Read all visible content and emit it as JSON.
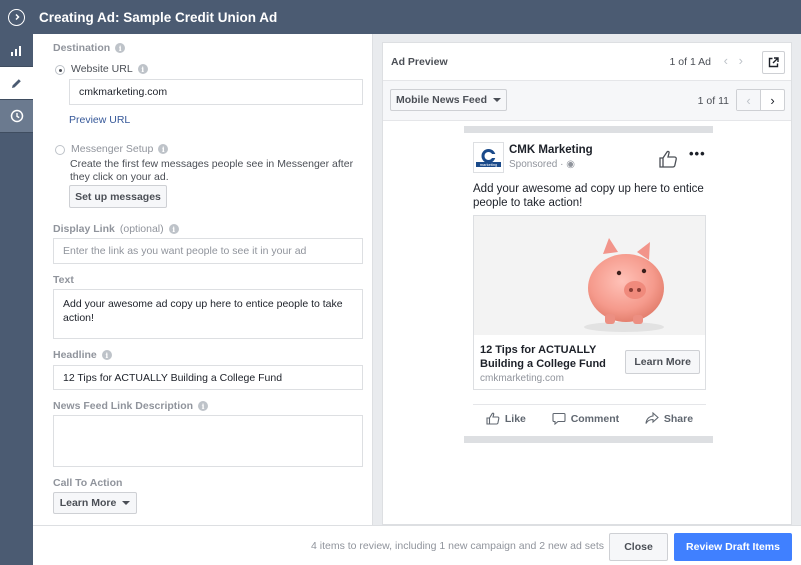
{
  "header": {
    "title": "Creating Ad: Sample Credit Union Ad"
  },
  "sidebar": {
    "items": [
      "reports-icon",
      "edit-icon",
      "history-icon"
    ]
  },
  "editor": {
    "destination": {
      "label": "Destination"
    },
    "website": {
      "label": "Website URL",
      "value": "cmkmarketing.com",
      "preview_link": "Preview URL",
      "selected": true
    },
    "messenger": {
      "label": "Messenger Setup",
      "description": "Create the first few messages people see in Messenger after they click on your ad.",
      "button": "Set up messages"
    },
    "display_link": {
      "label": "Display Link",
      "optional": "(optional)",
      "placeholder": "Enter the link as you want people to see it in your ad"
    },
    "text": {
      "label": "Text",
      "value": "Add your awesome ad copy up here to entice people to take action!"
    },
    "headline": {
      "label": "Headline",
      "value": "12 Tips for ACTUALLY Building a College Fund"
    },
    "news_feed_desc": {
      "label": "News Feed Link Description",
      "value": ""
    },
    "cta": {
      "label": "Call To Action",
      "value": "Learn More"
    }
  },
  "preview": {
    "title": "Ad Preview",
    "ad_count": "1 of 1 Ad",
    "placement": "Mobile News Feed",
    "placement_count": "1 of 11",
    "ad": {
      "page_name": "CMK Marketing",
      "sponsored": "Sponsored",
      "logo_text": "marketing",
      "copy": "Add your awesome ad copy up here to entice people to take action!",
      "headline": "12 Tips for ACTUALLY Building a College Fund",
      "domain": "cmkmarketing.com",
      "cta": "Learn More",
      "actions": {
        "like": "Like",
        "comment": "Comment",
        "share": "Share"
      }
    }
  },
  "footer": {
    "summary": "4 items to review, including 1 new campaign and 2 new ad sets",
    "close": "Close",
    "review": "Review Draft Items"
  },
  "colors": {
    "header": "#4b5b72",
    "primary": "#4080ff",
    "link": "#365899"
  }
}
